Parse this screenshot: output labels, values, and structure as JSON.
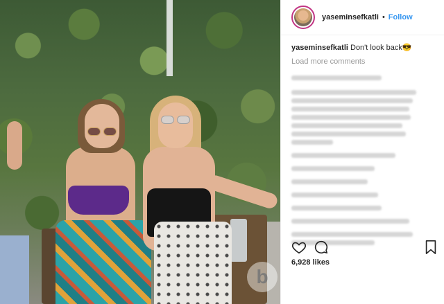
{
  "post": {
    "username": "yaseminsefkatli",
    "follow_label": "Follow",
    "separator": "•",
    "caption_user": "yaseminsefkatli",
    "caption_text": "Don't look back😎",
    "load_more": "Load more comments",
    "likes": "6,928 likes"
  },
  "watermark": "b",
  "colors": {
    "accent": "#3897f0",
    "text": "#262626",
    "muted": "#999999",
    "bikini": "#5c2a8a"
  },
  "icons": [
    "heart-icon",
    "comment-icon",
    "bookmark-icon"
  ]
}
